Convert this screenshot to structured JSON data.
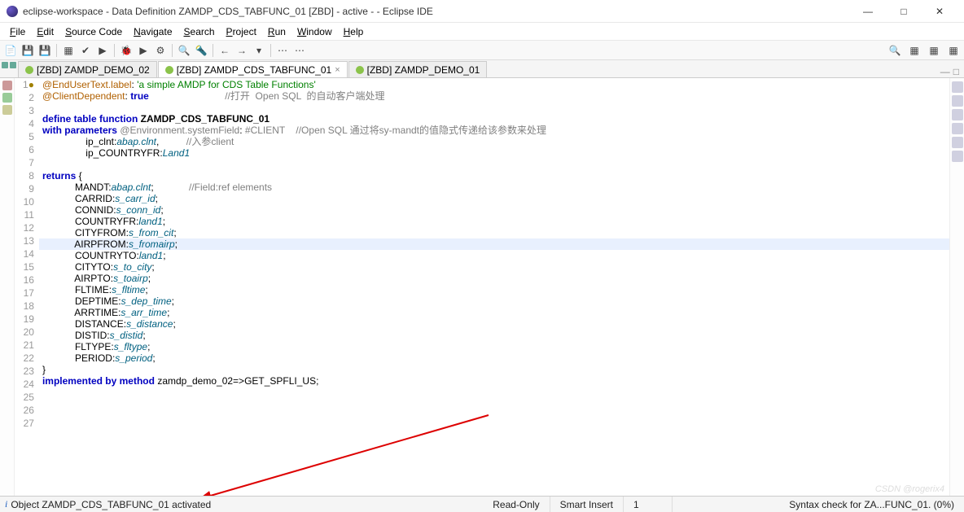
{
  "window": {
    "title": "eclipse-workspace - Data Definition ZAMDP_CDS_TABFUNC_01 [ZBD]  - active -                          - Eclipse IDE"
  },
  "menus": [
    "File",
    "Edit",
    "Source Code",
    "Navigate",
    "Search",
    "Project",
    "Run",
    "Window",
    "Help"
  ],
  "tabs": [
    {
      "label": "[ZBD] ZAMDP_DEMO_02",
      "active": false,
      "closable": false
    },
    {
      "label": "[ZBD] ZAMDP_CDS_TABFUNC_01",
      "active": true,
      "closable": true
    },
    {
      "label": "[ZBD] ZAMDP_DEMO_01",
      "active": false,
      "closable": false
    }
  ],
  "highlight_line": 15,
  "code": [
    {
      "n": 1,
      "marker": "●",
      "html": "<span class='ann2'>@EndUserText.label</span>: <span class='str'>'a simple AMDP for CDS Table Functions'</span>"
    },
    {
      "n": 2,
      "html": "<span class='ann2'>@ClientDependent</span>: <span class='kw'>true</span>                            <span class='cmt'>//打开  Open SQL  的自动客户端处理</span>"
    },
    {
      "n": 3,
      "html": ""
    },
    {
      "n": 4,
      "html": "<span class='kw'>define table function</span> <span class='fn'>ZAMDP_CDS_TABFUNC_01</span>"
    },
    {
      "n": 5,
      "html": "<span class='kw'>with parameters</span> <span class='ann'>@Environment.systemField</span>: <span class='ann'>#CLIENT</span>    <span class='cmt'>//Open SQL 通过将sy-mandt的值隐式传递给该参数来处理</span>"
    },
    {
      "n": 6,
      "html": "                ip_clnt:<span class='typ'>abap.clnt</span>,          <span class='cmt'>//入参client</span>"
    },
    {
      "n": 7,
      "html": "                ip_COUNTRYFR:<span class='typ'>Land1</span>"
    },
    {
      "n": 8,
      "html": ""
    },
    {
      "n": 9,
      "html": "<span class='kw'>returns</span> {"
    },
    {
      "n": 10,
      "html": "            MANDT:<span class='typ'>abap.clnt</span>;             <span class='cmt'>//Field:ref elements</span>"
    },
    {
      "n": 11,
      "html": "            CARRID:<span class='typ'>s_carr_id</span>;"
    },
    {
      "n": 12,
      "html": "            CONNID:<span class='typ'>s_conn_id</span>;"
    },
    {
      "n": 13,
      "html": "            COUNTRYFR:<span class='typ'>land1</span>;"
    },
    {
      "n": 14,
      "html": "            CITYFROM:<span class='typ'>s_from_cit</span>;"
    },
    {
      "n": 15,
      "html": "            AIRPFROM:<span class='typ'>s_fromairp</span>;"
    },
    {
      "n": 16,
      "html": "            COUNTRYTO:<span class='typ'>land1</span>;"
    },
    {
      "n": 17,
      "html": "            CITYTO:<span class='typ'>s_to_city</span>;"
    },
    {
      "n": 18,
      "html": "            AIRPTO:<span class='typ'>s_toairp</span>;"
    },
    {
      "n": 19,
      "html": "            FLTIME:<span class='typ'>s_fltime</span>;"
    },
    {
      "n": 20,
      "html": "            DEPTIME:<span class='typ'>s_dep_time</span>;"
    },
    {
      "n": 21,
      "html": "            ARRTIME:<span class='typ'>s_arr_time</span>;"
    },
    {
      "n": 22,
      "html": "            DISTANCE:<span class='typ'>s_distance</span>;"
    },
    {
      "n": 23,
      "html": "            DISTID:<span class='typ'>s_distid</span>;"
    },
    {
      "n": 24,
      "html": "            FLTYPE:<span class='typ'>s_fltype</span>;"
    },
    {
      "n": 25,
      "html": "            PERIOD:<span class='typ'>s_period</span>;"
    },
    {
      "n": 26,
      "html": "}"
    },
    {
      "n": 27,
      "html": "<span class='kw'>implemented by method</span> <span class='ident'>zamdp_demo_02</span>=&gt;<span class='ident'>GET_SPFLI_US</span>;"
    }
  ],
  "status": {
    "msg": "Object ZAMDP_CDS_TABFUNC_01 activated",
    "readonly": "Read-Only",
    "insert": "Smart Insert",
    "pos": "1",
    "syntax": "Syntax check for ZA...FUNC_01. (0%)"
  },
  "watermark": "CSDN @rogerix4"
}
